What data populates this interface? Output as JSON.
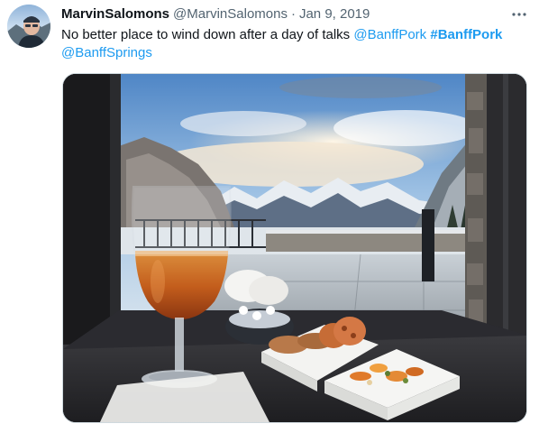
{
  "tweet": {
    "author": {
      "display_name": "MarvinSalomons",
      "handle": "@MarvinSalomons",
      "avatar_icon": "user-avatar"
    },
    "separator": "·",
    "date": "Jan 9, 2019",
    "more_icon": "more-horizontal-icon",
    "text": {
      "main": "No better place to wind down after a day of talks ",
      "mention1": "@BanffPork",
      "space": " ",
      "hashtag": "#BanffPork",
      "mention2": "@BanffSprings"
    },
    "media": {
      "type": "photo",
      "subject": "beer-glass-snacks-mountain-view"
    }
  },
  "colors": {
    "link": "#1d9bf0",
    "text": "#0f1419",
    "secondary": "#536471",
    "border": "#cfd9de"
  }
}
